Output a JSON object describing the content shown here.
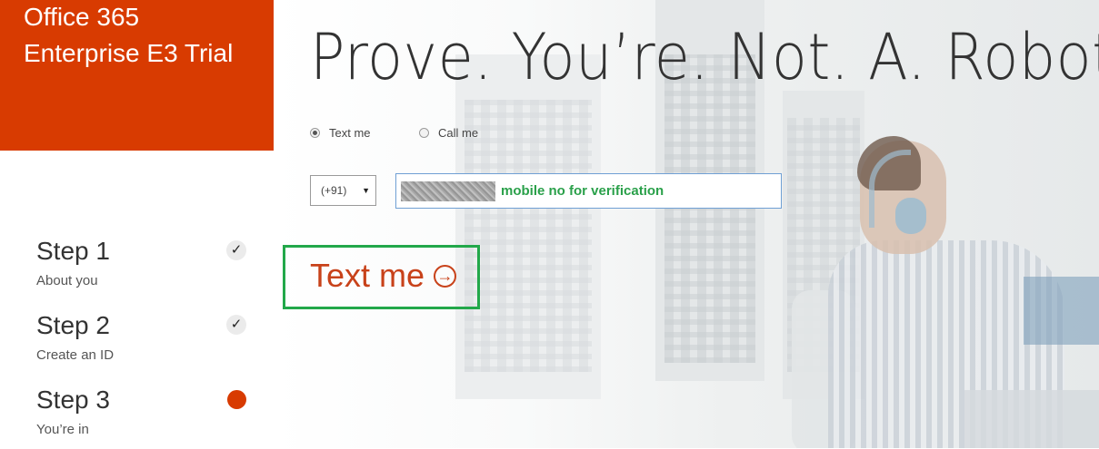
{
  "brand": {
    "line1": "Office 365",
    "line2": "Enterprise E3 Trial",
    "color": "#d83b01"
  },
  "headline": "Prove. You’re. Not. A. Robot.",
  "verification": {
    "options": [
      {
        "label": "Text me",
        "selected": true
      },
      {
        "label": "Call me",
        "selected": false
      }
    ],
    "country_code": "(+91)",
    "phone_hint": "mobile no for verification",
    "action_label": "Text me",
    "action_icon": "arrow-circle-right-icon"
  },
  "steps": [
    {
      "title": "Step 1",
      "subtitle": "About you",
      "status": "complete"
    },
    {
      "title": "Step 2",
      "subtitle": "Create an ID",
      "status": "complete"
    },
    {
      "title": "Step 3",
      "subtitle": "You’re in",
      "status": "current"
    }
  ],
  "colors": {
    "accent": "#d83b01",
    "highlight_frame": "#22a84a",
    "hint_text": "#2aa04a",
    "input_border": "#6f9fd4"
  }
}
